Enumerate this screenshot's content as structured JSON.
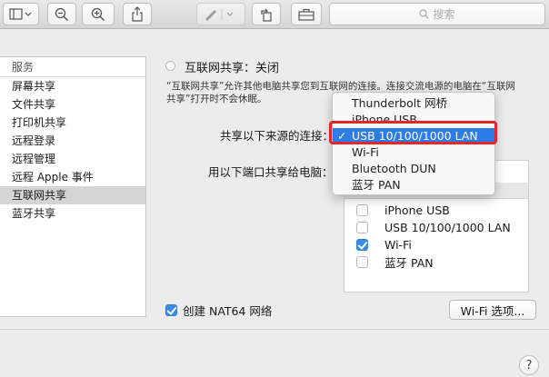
{
  "toolbar": {
    "search_placeholder": "搜索",
    "buttons": [
      "sidebar-toggle",
      "zoom-out",
      "zoom-in",
      "share",
      "markup",
      "rotate",
      "toolbox"
    ]
  },
  "sidebar": {
    "header": "服务",
    "items": [
      {
        "label": "屏幕共享"
      },
      {
        "label": "文件共享"
      },
      {
        "label": "打印机共享"
      },
      {
        "label": "远程登录"
      },
      {
        "label": "远程管理"
      },
      {
        "label": "远程 Apple 事件"
      },
      {
        "label": "互联网共享",
        "selected": true
      },
      {
        "label": "蓝牙共享"
      }
    ]
  },
  "main": {
    "title": "互联网共享：关闭",
    "description_line1": "“互联网共享”允许其他电脑共享您到互联网的连接。连接交流电源的电脑在“互联网",
    "description_line2": "共享”打开时不会休眠。",
    "share_from_label": "共享以下来源的连接：",
    "to_computers_label": "用以下端口共享给电脑：",
    "ports": [
      {
        "label": "iPhone USB",
        "checked": false
      },
      {
        "label": "USB 10/100/1000 LAN",
        "checked": false
      },
      {
        "label": "Wi-Fi",
        "checked": true
      },
      {
        "label": "蓝牙 PAN",
        "checked": false
      }
    ],
    "nat64_label": "创建 NAT64 网络",
    "nat64_checked": true,
    "wifi_options_button": "Wi-Fi 选项..."
  },
  "dropdown": {
    "items": [
      {
        "label": "Thunderbolt 网桥",
        "selected": false
      },
      {
        "label": "iPhone USB",
        "selected": false
      },
      {
        "label": "USB 10/100/1000 LAN",
        "selected": true
      },
      {
        "label": "Wi-Fi",
        "selected": false
      },
      {
        "label": "Bluetooth DUN",
        "selected": false
      },
      {
        "label": "蓝牙 PAN",
        "selected": false
      }
    ],
    "checkmark": "✓"
  },
  "colors": {
    "selection_blue": "#2d7de8",
    "highlight_red": "#e2262c",
    "checkbox_blue": "#3b8ce5"
  },
  "help_label": "?"
}
